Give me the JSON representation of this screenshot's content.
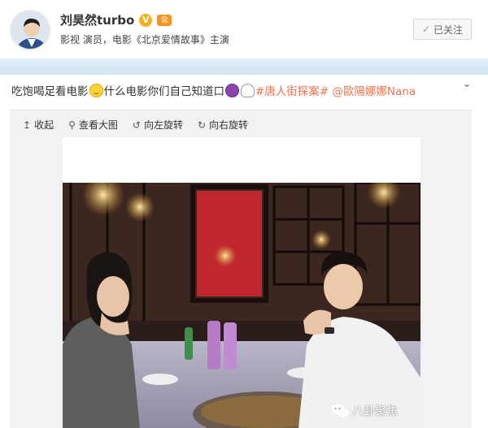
{
  "profile": {
    "name": "刘昊然turbo",
    "bio": "影视 演员，电影《北京爱情故事》主演",
    "verify_badge": "V",
    "member_badge": "会",
    "follow_label": "已关注"
  },
  "post": {
    "text_1": "吃饱喝足看电影",
    "text_2": "什么电影你们自己知道口",
    "hashtag": "#唐人街探案#",
    "mention": "@歐陽娜娜Nana"
  },
  "toolbar": {
    "collapse": "收起",
    "view_large": "查看大图",
    "rotate_left": "向左旋转",
    "rotate_right": "向右旋转"
  },
  "watermark": "八卦聚焦",
  "colors": {
    "link": "#eb7350",
    "verify": "#f6b11a",
    "header_strip": "#d6e8f4"
  }
}
